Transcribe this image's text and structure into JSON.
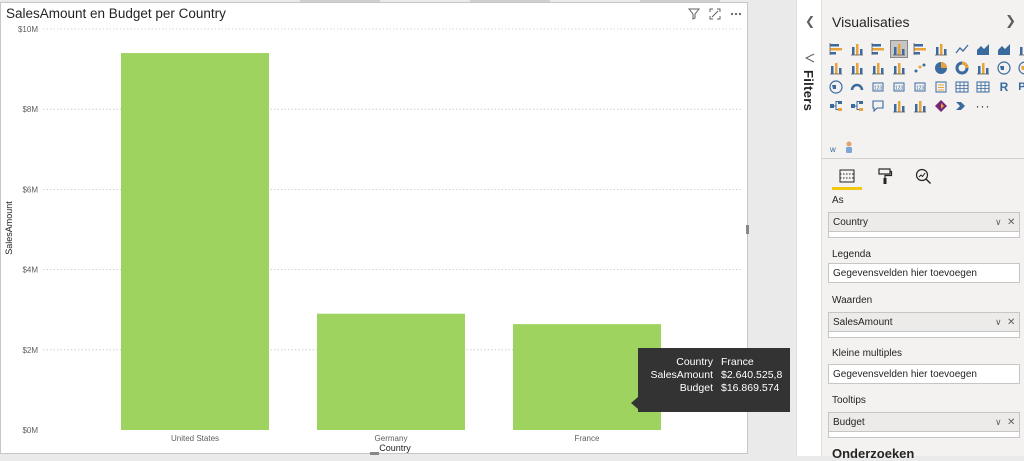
{
  "visual": {
    "title": "SalesAmount en Budget per Country",
    "tooltip": {
      "rows": [
        {
          "key": "Country",
          "value": "France"
        },
        {
          "key": "SalesAmount",
          "value": "$2.640.525,8"
        },
        {
          "key": "Budget",
          "value": "$16.869.574"
        }
      ]
    }
  },
  "chart_data": {
    "type": "bar",
    "title": "SalesAmount en Budget per Country",
    "xlabel": "Country",
    "ylabel": "SalesAmount",
    "categories": [
      "United States",
      "Germany",
      "France"
    ],
    "values": [
      9400000,
      2900000,
      2640525.8
    ],
    "ylim": [
      0,
      10000000
    ],
    "yticks": [
      0,
      2000000,
      4000000,
      6000000,
      8000000,
      10000000
    ],
    "ytick_labels": [
      "$0M",
      "$2M",
      "$4M",
      "$6M",
      "$8M",
      "$10M"
    ],
    "color": "#9dd35e",
    "grid": true
  },
  "filters": {
    "label": "Filters"
  },
  "viz_pane": {
    "title": "Visualisaties",
    "wells": {
      "as": {
        "label": "As",
        "field": "Country"
      },
      "legend": {
        "label": "Legenda",
        "placeholder": "Gegevensvelden hier toevoegen"
      },
      "values": {
        "label": "Waarden",
        "field": "SalesAmount"
      },
      "small_multiples": {
        "label": "Kleine multiples",
        "placeholder": "Gegevensvelden hier toevoegen"
      },
      "tooltips": {
        "label": "Tooltips",
        "field": "Budget"
      }
    },
    "bottom_section": "Onderzoeken"
  }
}
